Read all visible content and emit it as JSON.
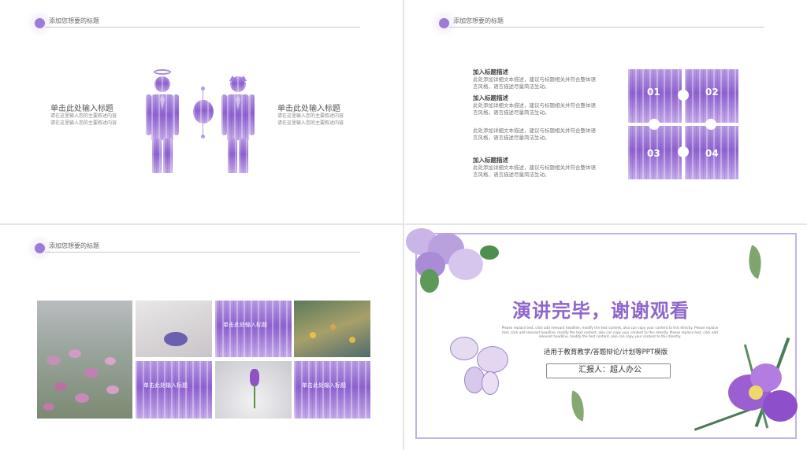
{
  "header": {
    "title": "添加您想要的标题"
  },
  "slide1": {
    "left_title": "单击此处输入标题",
    "left_desc": [
      "请在这里输入您的主要叙述内容",
      "请在这里输入您的主要叙述内容"
    ],
    "right_title": "单击此处输入标题",
    "right_desc": [
      "请在这里输入您的主要叙述内容",
      "请在这里输入您的主要叙述内容"
    ]
  },
  "slide2": {
    "blocks": [
      {
        "heading": "加入标题描述",
        "body": "此处添加详细文本描述，建议与标题相关并符合整体语言风格，语言描述尽量简洁生动。"
      },
      {
        "heading": "加入标题描述",
        "body": "此处添加详细文本描述，建议与标题相关并符合整体语言风格，语言描述尽量简洁生动。"
      },
      {
        "heading": "",
        "body": "此处添加详细文本描述，建议与标题相关并符合整体语言风格，语言描述尽量简洁生动。"
      },
      {
        "heading": "加入标题描述",
        "body": "此处添加详细文本描述，建议与标题相关并符合整体语言风格，语言描述尽量简洁生动。"
      }
    ],
    "puzzle_numbers": [
      "01",
      "02",
      "03",
      "04"
    ]
  },
  "slide3": {
    "tile_label": "单击此处输入标题"
  },
  "slide4": {
    "title": "演讲完毕，谢谢观看",
    "small_text": "Please replace text, click add relevant headline, modify the text content, also can copy your content to this directly. Please replace text, click add relevant headline, modify the text content, also can copy your content to this directly. Please replace text, click add relevant headline, modify the text content, also can copy your content to this directly.",
    "subtitle": "适用于教育教学/答题辩论/计划等PPT模版",
    "reporter": "汇报人：超人办公"
  },
  "colors": {
    "accent": "#9b7cd6",
    "title_purple": "#8e67cc"
  }
}
